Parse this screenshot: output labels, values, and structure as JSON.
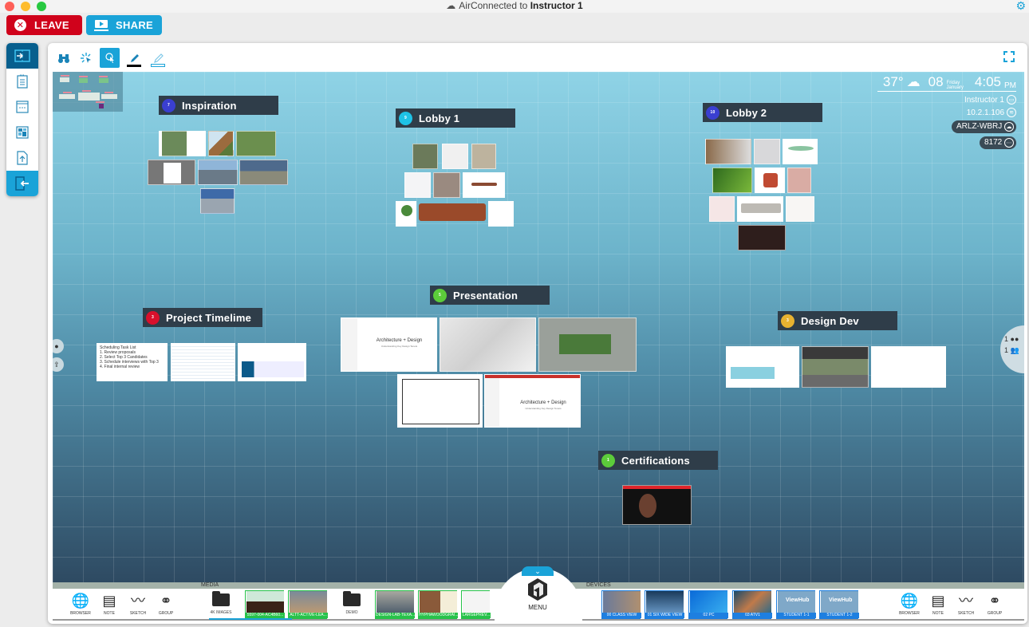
{
  "window": {
    "title_prefix": "AirConnected to ",
    "title_target": "Instructor 1"
  },
  "top_buttons": {
    "leave": "LEAVE",
    "share": "SHARE"
  },
  "sidebar": {
    "items": [
      {
        "icon": "split-screen-icon"
      },
      {
        "icon": "notes-icon"
      },
      {
        "icon": "window-icon"
      },
      {
        "icon": "tiles-icon"
      },
      {
        "icon": "upload-file-icon"
      },
      {
        "icon": "exit-icon"
      }
    ]
  },
  "toolbar": {
    "tools": [
      {
        "icon": "binoculars-icon",
        "glyph": "👓"
      },
      {
        "icon": "laser-pointer-icon",
        "glyph": "✳"
      },
      {
        "icon": "select-cursor-icon",
        "glyph": "↖",
        "active": true
      },
      {
        "icon": "pen-icon",
        "glyph": "✎"
      },
      {
        "icon": "highlighter-icon",
        "glyph": "✐"
      }
    ]
  },
  "info": {
    "temperature": "37°",
    "weather_icon": "☁",
    "day_number": "08",
    "day_name": "Friday",
    "month": "January",
    "time": "4:05",
    "ampm": "PM",
    "instructor": "Instructor 1",
    "ip": "10.2.1.106",
    "room_code": "ARLZ-WBRJ",
    "pin": "8172"
  },
  "groups": [
    {
      "label": "Inspiration",
      "count": "7",
      "color": "#3a3fd1"
    },
    {
      "label": "Lobby 1",
      "count": "9",
      "color": "#1ec2e6"
    },
    {
      "label": "Lobby 2",
      "count": "10",
      "color": "#3a3fd1"
    },
    {
      "label": "Project Timelime",
      "count": "3",
      "color": "#d8102c"
    },
    {
      "label": "Presentation",
      "count": "5",
      "color": "#5ccc3a"
    },
    {
      "label": "Design Dev",
      "count": "3",
      "color": "#e8b230"
    },
    {
      "label": "Certifications",
      "count": "1",
      "color": "#5ccc3a"
    }
  ],
  "thumb_text": {
    "task_list": [
      "Scheduling Task List",
      "1. Review proposals",
      "2. Select Top 3 Candidates",
      "3. Schedule interviews with Top 3",
      "4. Final internal review"
    ],
    "slide_title": "Architecture + Design",
    "slide_subtitle": "Understanding Key Design Tenets"
  },
  "side_panel": {
    "viewers": "1",
    "participants": "1"
  },
  "dock": {
    "media_label": "MEDIA",
    "devices_label": "DEVICES",
    "menu_label": "MENU",
    "left_tools": [
      "BROWSER",
      "NOTE",
      "SKETCH",
      "GROUP"
    ],
    "right_tools": [
      "BROWSER",
      "NOTE",
      "SKETCH",
      "GROUP"
    ],
    "media_items": [
      {
        "type": "folder",
        "label": "4K IMAGES"
      },
      {
        "type": "file",
        "label": "5597-004-AC4B60..."
      },
      {
        "type": "file",
        "label": "ALTT-ACTIVE-LEA..."
      },
      {
        "type": "folder",
        "label": "DEMO"
      },
      {
        "type": "file",
        "label": "DESIGN-LAB-TEXA..."
      },
      {
        "type": "file",
        "label": "HYPHAWOODGRAI..."
      },
      {
        "type": "file",
        "label": "LARGEPREV..."
      }
    ],
    "devices": [
      {
        "label": "00 CLASS VIEW"
      },
      {
        "label": "01 SIX WIDE VIEW"
      },
      {
        "label": "02 PC"
      },
      {
        "label": "03 ATV1"
      },
      {
        "label": "STUDENT 1-1"
      },
      {
        "label": "STUDENT 1-2"
      }
    ],
    "viewhub_text": "ViewHub"
  }
}
